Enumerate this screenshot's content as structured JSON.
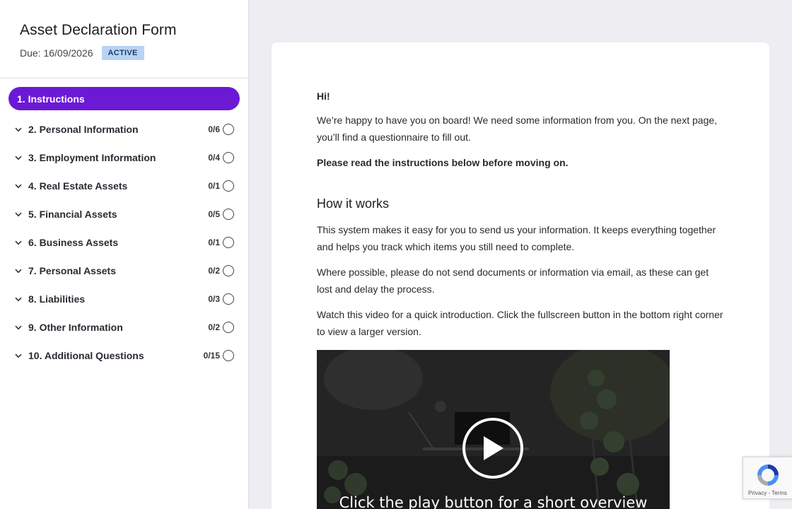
{
  "form": {
    "title": "Asset Declaration Form",
    "due": "Due: 16/09/2026",
    "status": "ACTIVE"
  },
  "nav": {
    "items": [
      {
        "label": "1. Instructions",
        "count": ""
      },
      {
        "label": "2. Personal Information",
        "count": "0/6"
      },
      {
        "label": "3. Employment Information",
        "count": "0/4"
      },
      {
        "label": "4. Real Estate Assets",
        "count": "0/1"
      },
      {
        "label": "5. Financial Assets",
        "count": "0/5"
      },
      {
        "label": "6. Business Assets",
        "count": "0/1"
      },
      {
        "label": "7. Personal Assets",
        "count": "0/2"
      },
      {
        "label": "8. Liabilities",
        "count": "0/3"
      },
      {
        "label": "9. Other Information",
        "count": "0/2"
      },
      {
        "label": "10. Additional Questions",
        "count": "0/15"
      }
    ]
  },
  "content": {
    "greeting": "Hi!",
    "intro": "We’re happy to have you on board! We need some information from you. On the next page, you’ll find a questionnaire to fill out.",
    "instruction": "Please read the instructions below before moving on.",
    "heading": "How it works",
    "p1": "This system makes it easy for you to send us your information. It keeps everything together and helps you track which items you still need to complete.",
    "p2": "Where possible, please do not send documents or information via email, as these can get lost and delay the process.",
    "p3": "Watch this video for a quick introduction. Click the fullscreen button in the bottom right corner to view a larger version.",
    "video_caption": "Click the play button for a short overview"
  },
  "recaptcha": {
    "text": "Privacy - Terms"
  },
  "colors": {
    "accent": "#6c19d6",
    "badge_bg": "#b9d3f5",
    "page_bg": "#eeedf1"
  }
}
